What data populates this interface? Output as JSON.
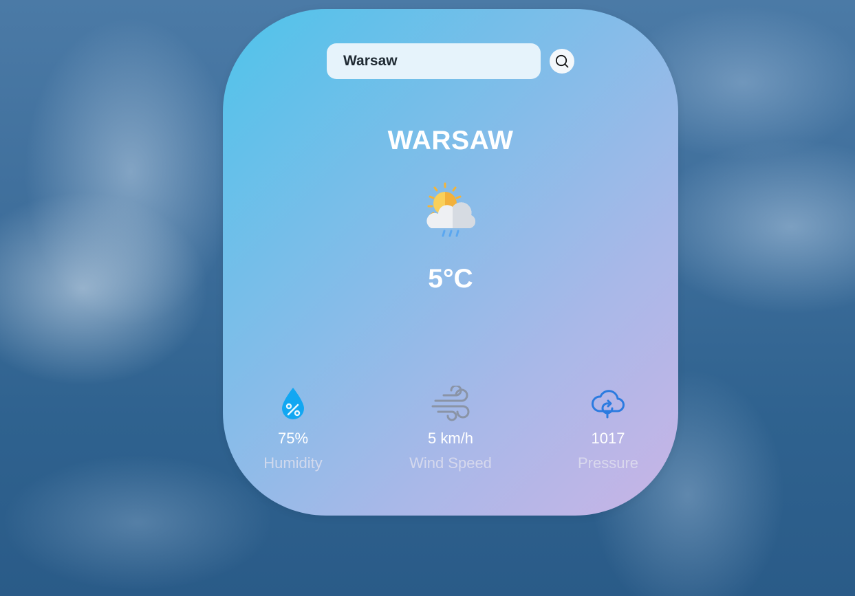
{
  "search": {
    "value": "Warsaw",
    "button_icon": "search-icon"
  },
  "weather": {
    "city": "WARSAW",
    "condition_icon": "partly-cloudy-rain-icon",
    "temperature": "5°C"
  },
  "stats": {
    "humidity": {
      "value": "75%",
      "label": "Humidity",
      "icon": "humidity-drop-icon"
    },
    "wind": {
      "value": "5 km/h",
      "label": "Wind Speed",
      "icon": "wind-icon"
    },
    "pressure": {
      "value": "1017",
      "label": "Pressure",
      "icon": "pressure-cloud-icon"
    }
  },
  "colors": {
    "card_gradient_start": "#4fc3ea",
    "card_gradient_end": "#c9b4e6",
    "search_bg": "#e6f3fb",
    "humidity_icon": "#12a7f2",
    "wind_icon": "#8a94a6",
    "pressure_icon": "#2b7be0"
  }
}
